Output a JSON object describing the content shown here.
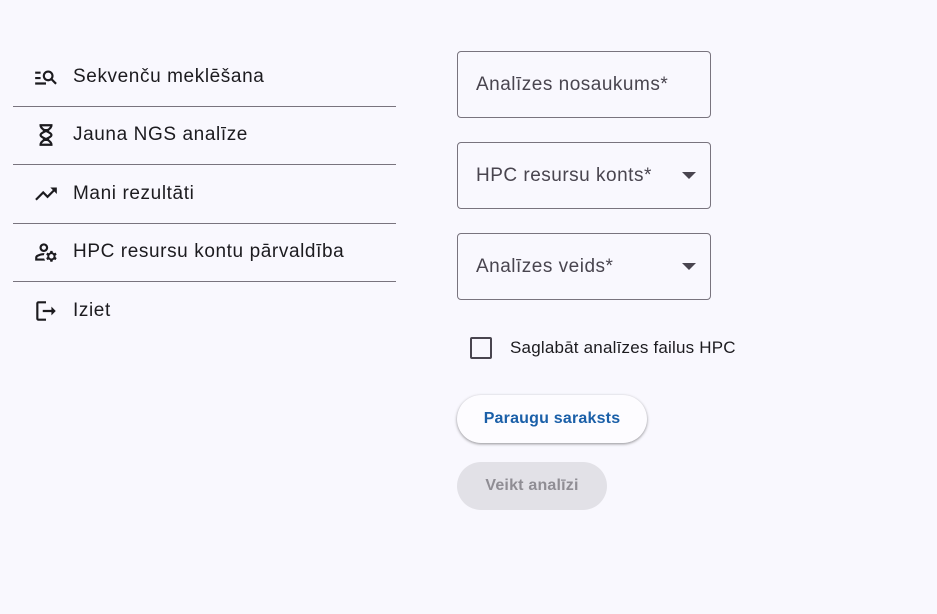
{
  "nav": {
    "items": [
      {
        "label": "Sekvenču meklēšana",
        "icon": "manage-search-icon"
      },
      {
        "label": "Jauna NGS analīze",
        "icon": "dna-hourglass-icon"
      },
      {
        "label": "Mani rezultāti",
        "icon": "trending-up-icon"
      },
      {
        "label": "HPC resursu kontu pārvaldība",
        "icon": "manage-accounts-icon"
      },
      {
        "label": "Iziet",
        "icon": "logout-icon"
      }
    ]
  },
  "form": {
    "analysis_name_placeholder": "Analīzes nosaukums*",
    "hpc_account_placeholder": "HPC resursu konts*",
    "analysis_type_placeholder": "Analīzes veids*",
    "save_files_label": "Saglabāt analīzes failus HPC",
    "save_files_checked": false,
    "sample_list_button": "Paraugu saraksts",
    "run_button": "Veikt analīzi"
  },
  "colors": {
    "background": "#f9f8fe",
    "primary": "#1a5fa8",
    "outline": "#79747e",
    "disabled_bg": "#e2e1e7"
  }
}
